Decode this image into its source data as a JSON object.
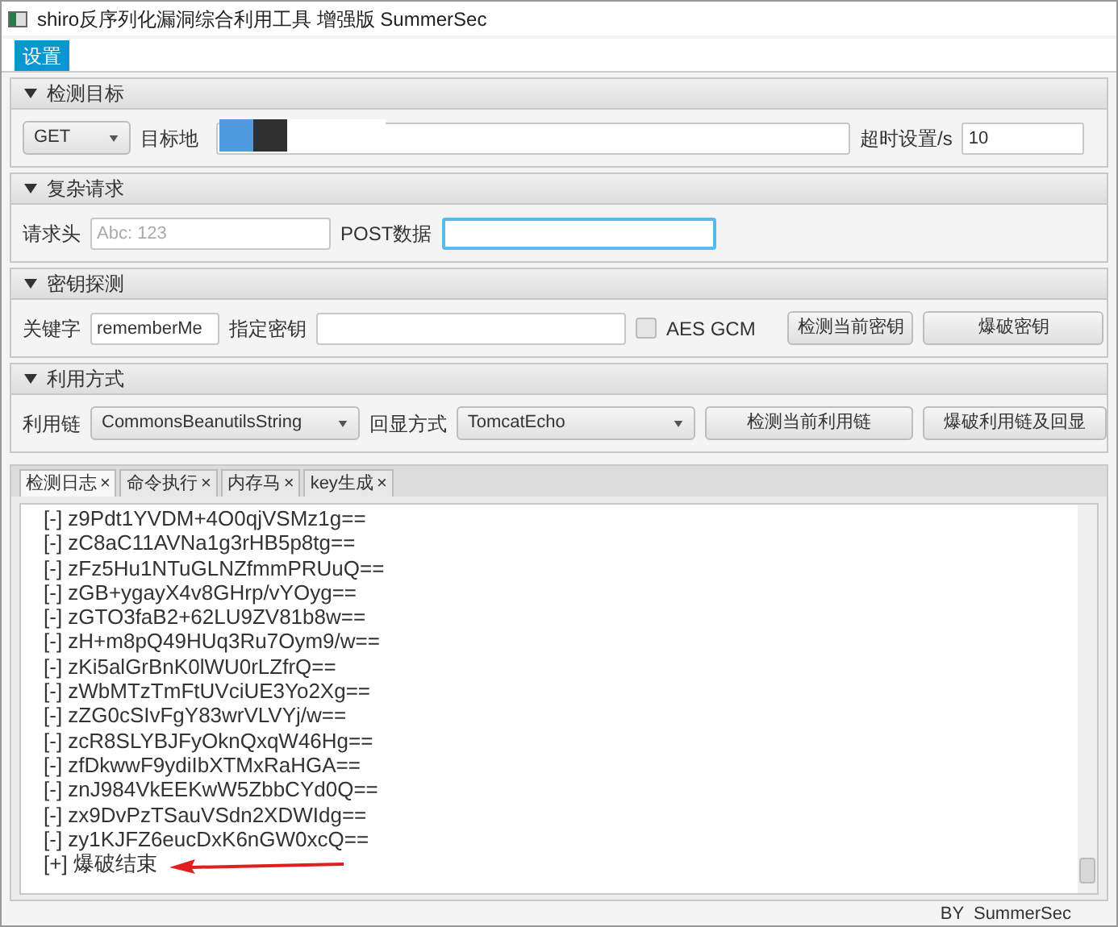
{
  "window": {
    "title": "shiro反序列化漏洞综合利用工具 增强版 SummerSec"
  },
  "menu": [
    {
      "label": "设置",
      "selected": true
    }
  ],
  "sections": [
    {
      "title": "检测目标",
      "expanded": true,
      "fields": [
        {
          "kind": "select",
          "value": "GET"
        },
        {
          "kind": "label",
          "text": "目标地"
        },
        {
          "kind": "input",
          "focused": false
        },
        {
          "kind": "label",
          "text": "超时设置/s"
        },
        {
          "kind": "input",
          "value": "10",
          "focused": false
        }
      ]
    },
    {
      "title": "复杂请求",
      "expanded": true,
      "fields": [
        {
          "kind": "label",
          "text": "请求头"
        },
        {
          "kind": "input",
          "placeholder": "Abc: 123",
          "focused": false
        },
        {
          "kind": "label",
          "text": "POST数据"
        },
        {
          "kind": "input",
          "focused": true
        }
      ]
    },
    {
      "title": "密钥探测",
      "expanded": true,
      "fields": [
        {
          "kind": "label",
          "text": "关键字"
        },
        {
          "kind": "input",
          "value": "rememberMe",
          "focused": false
        },
        {
          "kind": "label",
          "text": "指定密钥"
        },
        {
          "kind": "input",
          "focused": false
        },
        {
          "kind": "checkbox",
          "text": "AES GCM",
          "checked": false
        },
        {
          "kind": "button",
          "text": "检测当前密钥"
        },
        {
          "kind": "button",
          "text": "爆破密钥"
        }
      ]
    },
    {
      "title": "利用方式",
      "expanded": true,
      "fields": [
        {
          "kind": "label",
          "text": "利用链"
        },
        {
          "kind": "select",
          "value": "CommonsBeanutilsString"
        },
        {
          "kind": "label",
          "text": "回显方式"
        },
        {
          "kind": "select",
          "value": "TomcatEcho"
        },
        {
          "kind": "button",
          "text": "检测当前利用链"
        },
        {
          "kind": "button",
          "text": "爆破利用链及回显"
        }
      ]
    }
  ],
  "tabs": [
    {
      "label": "检测日志",
      "close": "×",
      "selected": true
    },
    {
      "label": "命令执行",
      "close": "×",
      "selected": false
    },
    {
      "label": "内存马",
      "close": "×",
      "selected": false
    },
    {
      "label": "key生成",
      "close": "×",
      "selected": false
    }
  ],
  "log": [
    "[-] z9Pdt1YVDM+4O0qjVSMz1g==",
    "[-] zC8aC11AVNa1g3rHB5p8tg==",
    "[-] zFz5Hu1NTuGLNZfmmPRUuQ==",
    "[-] zGB+ygayX4v8GHrp/vYOyg==",
    "[-] zGTO3faB2+62LU9ZV81b8w==",
    "[-] zH+m8pQ49HUq3Ru7Oym9/w==",
    "[-] zKi5alGrBnK0lWU0rLZfrQ==",
    "[-] zWbMTzTmFtUVciUE3Yo2Xg==",
    "[-] zZG0cSIvFgY83wrVLVYj/w==",
    "[-] zcR8SLYBJFyOknQxqW46Hg==",
    "[-] zfDkwwF9ydiIbXTMxRaHGA==",
    "[-] znJ984VkEEKwW5ZbbCYd0Q==",
    "[-] zx9DvPzTSauVSdn2XDWIdg==",
    "[-] zy1KJFZ6eucDxK6nGW0xcQ==",
    "[+] 爆破结束"
  ],
  "status_bar": "BY  SummerSec"
}
